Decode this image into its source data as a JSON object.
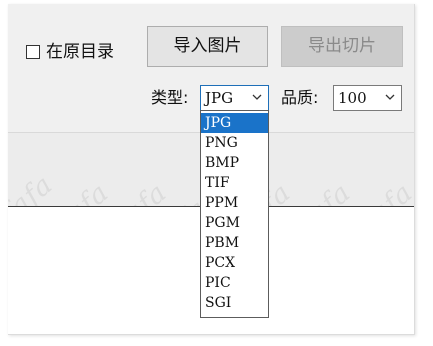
{
  "options_bar": {
    "checkbox_label": "在原目录",
    "checkbox_checked": false,
    "import_button": "导入图片",
    "export_button": "导出切片",
    "export_enabled": false
  },
  "format": {
    "label": "类型:",
    "selected": "JPG",
    "options": [
      "JPG",
      "PNG",
      "BMP",
      "TIF",
      "PPM",
      "PGM",
      "PBM",
      "PCX",
      "PIC",
      "SGI"
    ]
  },
  "quality": {
    "label": "品质:",
    "value": "100"
  },
  "watermark": {
    "text": "fafa"
  },
  "colors": {
    "accent": "#1a73c9",
    "toolbar_bg": "#f0f0f0",
    "disabled_text": "#8a8a8a"
  }
}
